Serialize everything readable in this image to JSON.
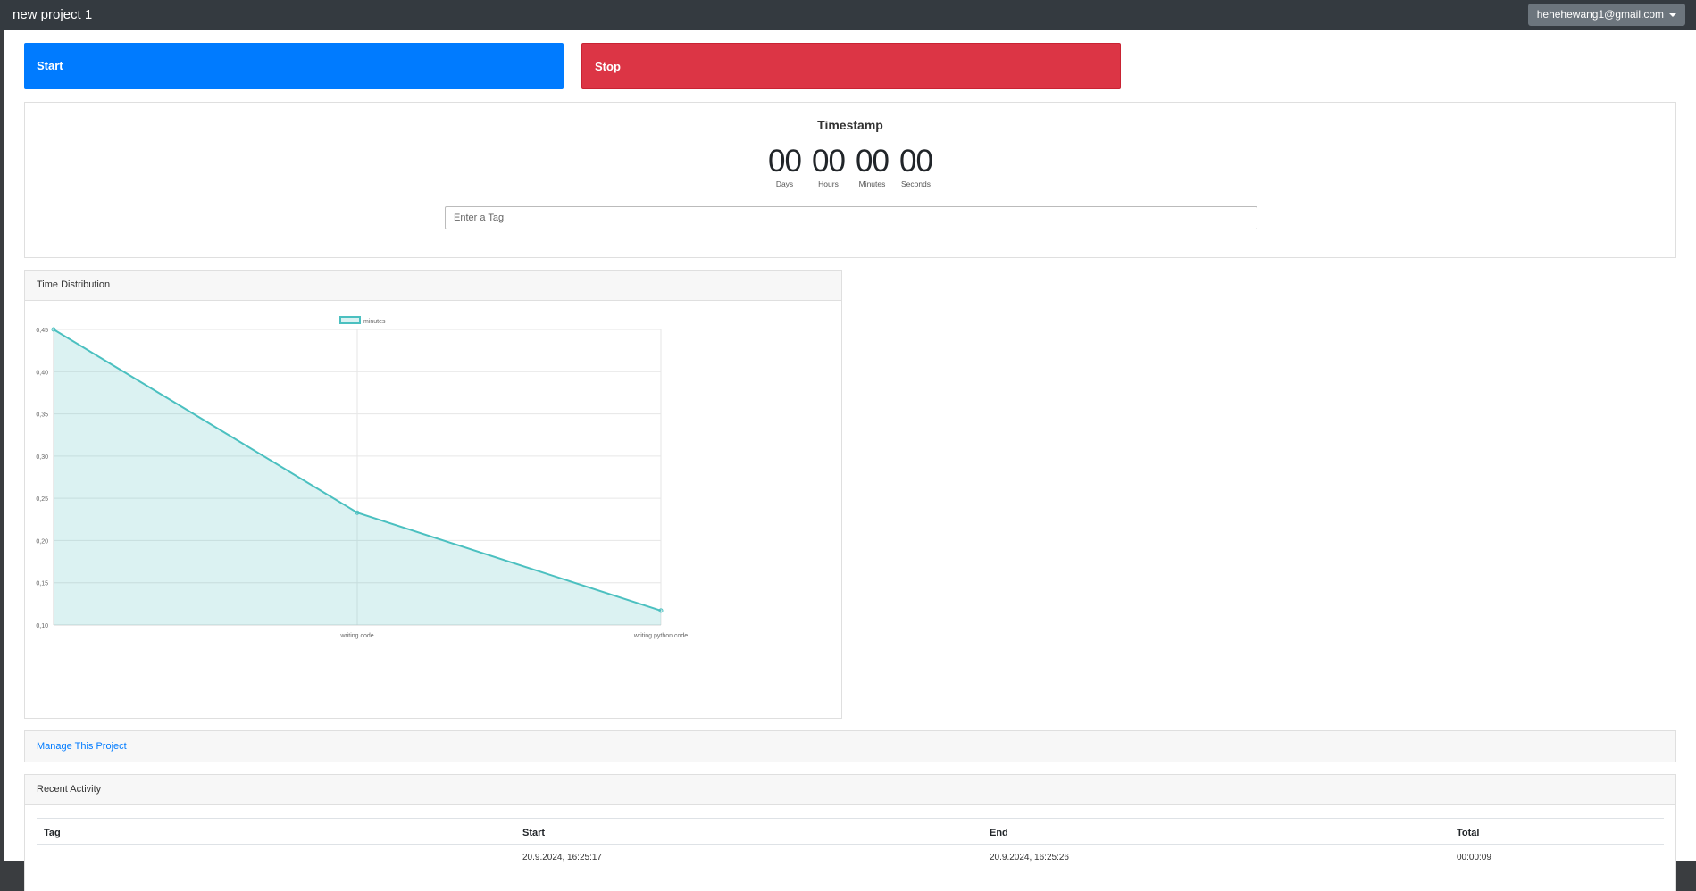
{
  "navbar": {
    "title": "new project 1",
    "user_email": "hehehewang1@gmail.com"
  },
  "actions": {
    "start_label": "Start",
    "stop_label": "Stop"
  },
  "timestamp": {
    "title": "Timestamp",
    "units": [
      {
        "value": "00",
        "label": "Days"
      },
      {
        "value": "00",
        "label": "Hours"
      },
      {
        "value": "00",
        "label": "Minutes"
      },
      {
        "value": "00",
        "label": "Seconds"
      }
    ],
    "tag_placeholder": "Enter a Tag"
  },
  "time_distribution": {
    "header": "Time Distribution"
  },
  "chart_data": {
    "type": "line",
    "categories": [
      "",
      "writing code",
      "writing python code"
    ],
    "series": [
      {
        "name": "minutes",
        "values": [
          0.45,
          0.233,
          0.117
        ],
        "color": "#4bc0c0",
        "fill": "rgba(75,192,192,0.2)"
      }
    ],
    "yticks": [
      "0,10",
      "0,15",
      "0,20",
      "0,25",
      "0,30",
      "0,35",
      "0,40",
      "0,45"
    ],
    "ylim": [
      0.1,
      0.45
    ],
    "legend": "top",
    "grid": true
  },
  "manage": {
    "link_label": "Manage This Project"
  },
  "activity": {
    "header": "Recent Activity",
    "columns": [
      "Tag",
      "Start",
      "End",
      "Total"
    ],
    "rows": [
      [
        "",
        "20.9.2024, 16:25:17",
        "20.9.2024, 16:25:26",
        "00:00:09"
      ]
    ]
  }
}
